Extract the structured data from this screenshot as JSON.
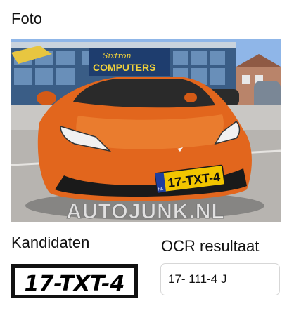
{
  "photo_section": {
    "title": "Foto",
    "watermark": "AUTOJUNK.NL",
    "plate_text": "17-TXT-4",
    "plate_country": "NL",
    "store_sign_top": "Sixtron",
    "store_sign_bottom": "COMPUTERS"
  },
  "candidates_section": {
    "title": "Kandidaten",
    "candidate_plate": "17-TXT-4"
  },
  "ocr_section": {
    "title": "OCR resultaat",
    "value": "17- 111-4 J"
  },
  "colors": {
    "car": "#e2661d",
    "plate_yellow": "#f2c500",
    "plate_blue": "#1f3fa0",
    "sky": "#8fb6e8"
  }
}
